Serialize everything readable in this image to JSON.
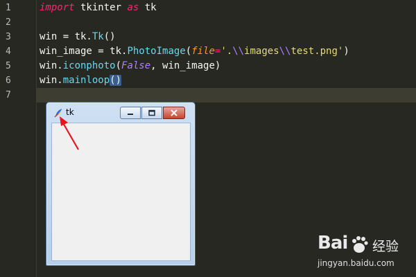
{
  "editor": {
    "line_numbers": [
      "1",
      "2",
      "3",
      "4",
      "5",
      "6",
      "7"
    ],
    "line1": {
      "kw1": "import",
      "t1": " tkinter ",
      "kw2": "as",
      "t2": " tk"
    },
    "line3": {
      "t1": "win = tk.",
      "cls": "Tk",
      "t2": "()"
    },
    "line4": {
      "t1": "win_image = tk.",
      "cls": "PhotoImage",
      "t2": "(",
      "param": "file",
      "t3": "=",
      "s1": "'.",
      "e1": "\\\\",
      "s2": "images",
      "e2": "\\\\",
      "s3": "test.png'",
      "t4": ")"
    },
    "line5": {
      "t1": "win.",
      "cls": "iconphoto",
      "t2": "(",
      "const": "False",
      "t3": ", win_image)"
    },
    "line6": {
      "t1": "win.",
      "cls": "mainloop",
      "paren": "()"
    }
  },
  "tk_window": {
    "title": "tk",
    "icon": "tk-feather-icon",
    "buttons": [
      "minimize-icon",
      "maximize-icon",
      "close-icon"
    ]
  },
  "annotation": {
    "icon": "red-arrow-icon",
    "color": "#e8141b"
  },
  "watermark": {
    "logo": "Bai",
    "site": "经验",
    "url": "jingyan.baidu.com"
  }
}
